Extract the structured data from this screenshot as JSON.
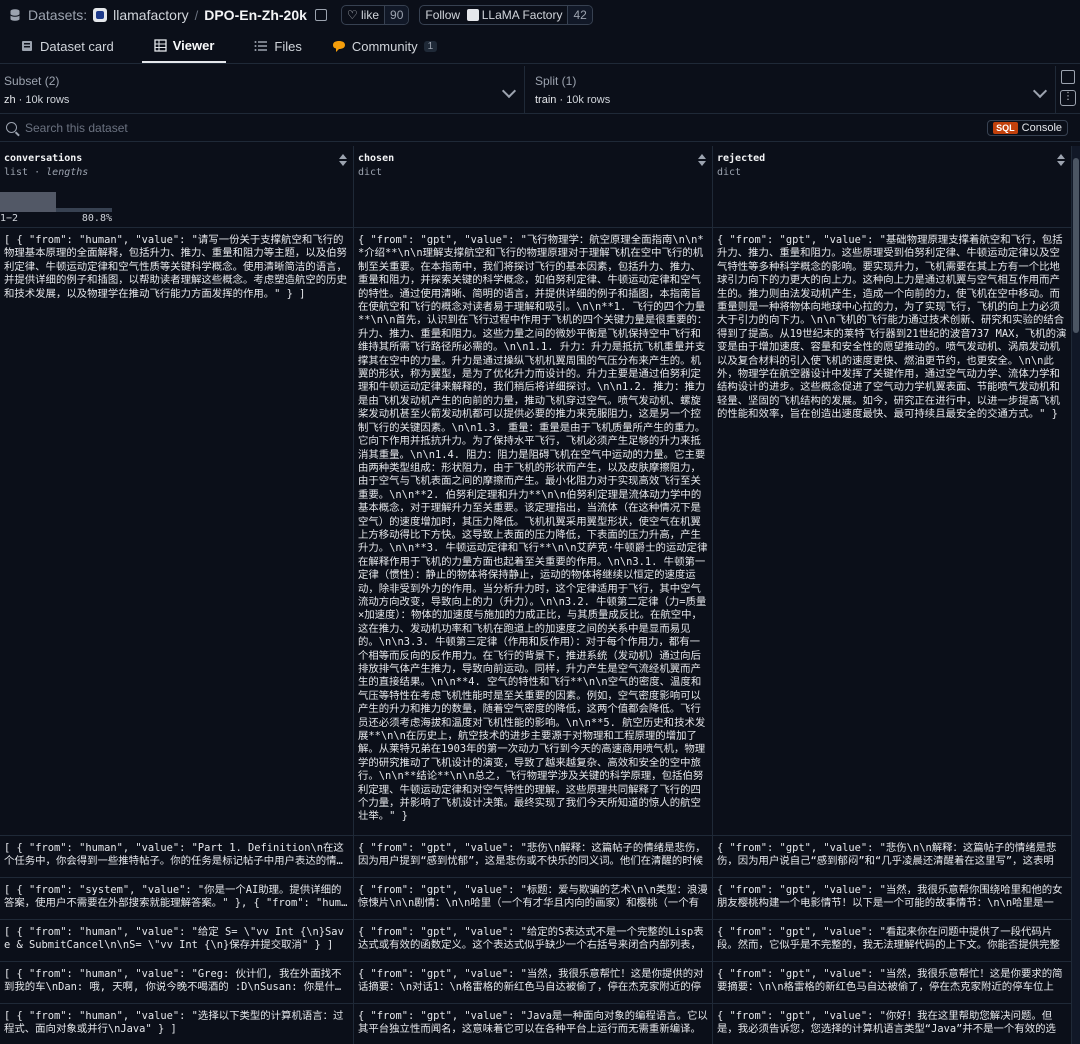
{
  "header": {
    "datasets_label": "Datasets:",
    "org": "llamafactory",
    "slash": "/",
    "dataset_name": "DPO-En-Zh-20k",
    "like_label": "like",
    "like_count": "90",
    "follow_label": "Follow",
    "follow_org": "LLaMA Factory",
    "follow_count": "42"
  },
  "tabs": [
    {
      "label": "Dataset card"
    },
    {
      "label": "Viewer"
    },
    {
      "label": "Files"
    },
    {
      "label": "Community",
      "badge": "1"
    }
  ],
  "subset": {
    "label": "Subset (2)",
    "value": "zh",
    "rows": "10k rows"
  },
  "split": {
    "label": "Split (1)",
    "value": "train",
    "rows": "10k rows"
  },
  "search": {
    "placeholder": "Search this dataset"
  },
  "sql": {
    "badge": "SQL",
    "label": "Console"
  },
  "columns": [
    {
      "name": "conversations",
      "type": "list",
      "subtype": "lengths",
      "hist_min": "1−2",
      "hist_pct": "80.8%"
    },
    {
      "name": "chosen",
      "type": "dict"
    },
    {
      "name": "rejected",
      "type": "dict"
    }
  ],
  "rows": [
    {
      "conversations": "[ { \"from\": \"human\", \"value\": \"请写一份关于支撑航空和飞行的物理基本原理的全面解释，包括升力、推力、重量和阻力等主题，以及伯努利定律、牛顿运动定律和空气性质等关键科学概念。使用清晰简洁的语言，并提供详细的例子和插图，以帮助读者理解这些概念。考虑塑造航空的历史和技术发展，以及物理学在推动飞行能力方面发挥的作用。\" } ]",
      "chosen": "{ \"from\": \"gpt\", \"value\": \"飞行物理学：航空原理全面指南\\n\\n**介绍**\\n\\n理解支撑航空和飞行的物理原理对于理解飞机在空中飞行的机制至关重要。在本指南中，我们将探讨飞行的基本因素，包括升力、推力、重量和阻力，并探索关键的科学概念，如伯努利定律、牛顿运动定律和空气的特性。通过使用清晰、简明的语言，并提供详细的例子和插图，本指南旨在使航空和飞行的概念对读者易于理解和吸引。\\n\\n**1. 飞行的四个力量**\\n\\n首先，认识到在飞行过程中作用于飞机的四个关键力量是很重要的：升力、推力、重量和阻力。这些力量之间的微妙平衡是飞机保持空中飞行和维持其所需飞行路径所必需的。\\n\\n1.1. 升力：升力是抵抗飞机重量并支撑其在空中的力量。升力是通过操纵飞机机翼周围的气压分布来产生的。机翼的形状，称为翼型，是为了优化升力而设计的。升力主要是通过伯努利定理和牛顿运动定律来解释的，我们稍后将详细探讨。\\n\\n1.2. 推力：推力是由飞机发动机产生的向前的力量，推动飞机穿过空气。喷气发动机、螺旋桨发动机甚至火箭发动机都可以提供必要的推力来克服阻力，这是另一个控制飞行的关键因素。\\n\\n1.3. 重量：重量是由于飞机质量所产生的重力。它向下作用并抵抗升力。为了保持水平飞行，飞机必须产生足够的升力来抵消其重量。\\n\\n1.4. 阻力：阻力是阻碍飞机在空气中运动的力量。它主要由两种类型组成：形状阻力，由于飞机的形状而产生，以及皮肤摩擦阻力，由于空气与飞机表面之间的摩擦而产生。最小化阻力对于实现高效飞行至关重要。\\n\\n**2. 伯努利定理和升力**\\n\\n伯努利定理是流体动力学中的基本概念，对于理解升力至关重要。该定理指出，当流体（在这种情况下是空气）的速度增加时，其压力降低。飞机机翼采用翼型形状，使空气在机翼上方移动得比下方快。这导致上表面的压力降低，下表面的压力升高，产生升力。\\n\\n**3. 牛顿运动定律和飞行**\\n\\n艾萨克·牛顿爵士的运动定律在解释作用于飞机的力量方面也起着至关重要的作用。\\n\\n3.1. 牛顿第一定律（惯性）：静止的物体将保持静止，运动的物体将继续以恒定的速度运动，除非受到外力的作用。当分析升力时，这个定律适用于飞行，其中空气流动方向改变，导致向上的力（升力）。\\n\\n3.2. 牛顿第二定律（力=质量×加速度）：物体的加速度与施加的力成正比，与其质量成反比。在航空中，这在推力、发动机功率和飞机在跑道上的加速度之间的关系中是显而易见的。\\n\\n3.3. 牛顿第三定律（作用和反作用）：对于每个作用力，都有一个相等而反向的反作用力。在飞行的背景下，推进系统（发动机）通过向后排放排气体产生推力，导致向前运动。同样，升力产生是空气流经机翼而产生的直接结果。\\n\\n**4. 空气的特性和飞行**\\n\\n空气的密度、温度和气压等特性在考虑飞机性能时是至关重要的因素。例如，空气密度影响可以产生的升力和推力的数量，随着空气密度的降低，这两个值都会降低。飞行员还必须考虑海拔和温度对飞机性能的影响。\\n\\n**5. 航空历史和技术发展**\\n\\n在历史上，航空技术的进步主要源于对物理和工程原理的增加了解。从莱特兄弟在1903年的第一次动力飞行到今天的高速商用喷气机，物理学的研究推动了飞机设计的演变，导致了越来越复杂、高效和安全的空中旅行。\\n\\n**结论**\\n\\n总之，飞行物理学涉及关键的科学原理，包括伯努利定理、牛顿运动定律和对空气特性的理解。这些原理共同解释了飞行的四个力量，并影响了飞机设计决策。最终实现了我们今天所知道的惊人的航空壮举。\" }",
      "rejected": "{ \"from\": \"gpt\", \"value\": \"基础物理原理支撑着航空和飞行，包括升力、推力、重量和阻力。这些原理受到伯努利定律、牛顿运动定律以及空气特性等多种科学概念的影响。要实现升力，飞机需要在其上方有一个比地球引力向下的力更大的向上力。这种向上力是通过机翼与空气相互作用而产生的。推力则由法发动机产生，造成一个向前的力，使飞机在空中移动。而重量则是一种将物体向地球中心拉的力，为了实现飞行，飞机的向上力必须大于引力的向下力。\\n\\n飞机的飞行能力通过技术创新、研究和实验的结合得到了提高。从19世纪末的莱特飞行器到21世纪的波音737 MAX，飞机的演变是由于增加速度、容量和安全性的愿望推动的。喷气发动机、涡扇发动机以及复合材料的引入使飞机的速度更快、燃油更节约，也更安全。\\n\\n此外，物理学在航空器设计中发挥了关键作用，通过空气动力学、流体力学和结构设计的进步。这些概念促进了空气动力学机翼表面、节能喷气发动机和轻量、坚固的飞机结构的发展。如今，研究正在进行中，以进一步提高飞机的性能和效率，旨在创造出速度最快、最可持续且最安全的交通方式。\" }"
    },
    {
      "conversations": "[ { \"from\": \"human\", \"value\": \"Part 1. Definition\\n在这个任务中，你会得到一些推特帖子。你的任务是标记帖子中用户表达的情绪，",
      "chosen": "{ \"from\": \"gpt\", \"value\": \"悲伤\\n解释：这篇帖子的情绪是悲伤，因为用户提到“感到忧郁”，这是悲伤或不快乐的同义词。他们在清醒的时候",
      "rejected": "{ \"from\": \"gpt\", \"value\": \"悲伤\\n\\n解释：这篇帖子的情绪是悲伤，因为用户说自己“感到郁闷”和“几乎凌晨还清醒着在这里写”，这表明"
    },
    {
      "conversations": "[ { \"from\": \"system\", \"value\": \"你是一个AI助理。提供详细的答案，使用户不需要在外部搜索就能理解答案。\" }, { \"from\": \"human\",",
      "chosen": "{ \"from\": \"gpt\", \"value\": \"标题：爱与欺骗的艺术\\n\\n类型：浪漫惊悚片\\n\\n剧情：\\n\\n哈里（一个有才华且内向的画家）和樱桃（一个有",
      "rejected": "{ \"from\": \"gpt\", \"value\": \"当然，我很乐意帮你围绕哈里和他的女朋友樱桃构建一个电影情节！以下是一个可能的故事情节：\\n\\n哈里是一"
    },
    {
      "conversations": "[ { \"from\": \"human\", \"value\": \"给定 S= \\\"vv Int {\\n}Save & SubmitCancel\\n\\nS= \\\"vv Int {\\n}保存并提交取消\" } ]",
      "chosen": "{ \"from\": \"gpt\", \"value\": \"给定的S表达式不是一个完整的Lisp表达式或有效的函数定义。这个表达式似乎缺少一个右括号来闭合内部列表，",
      "rejected": "{ \"from\": \"gpt\", \"value\": \"看起来你在问题中提供了一段代码片段。然而，它似乎是不完整的，我无法理解代码的上下文。你能否提供完整"
    },
    {
      "conversations": "[ { \"from\": \"human\", \"value\": \"Greg: 伙计们, 我在外面找不到我的车\\nDan: 哦, 天啊, 你说今晚不喝酒的 :D\\nSusan: 你是什么意",
      "chosen": "{ \"from\": \"gpt\", \"value\": \"当然，我很乐意帮忙！这是你提供的对话摘要：\\n对话1：\\n格雷格的新红色马自达被偷了，停在杰克家附近的停",
      "rejected": "{ \"from\": \"gpt\", \"value\": \"当然，我很乐意帮忙！这是你要求的简要摘要：\\n\\n格雷格的新红色马自达被偷了，停在杰克家附近的停车位上"
    },
    {
      "conversations": "[ { \"from\": \"human\", \"value\": \"选择以下类型的计算机语言：过程式、面向对象或并行\\nJava\" } ]",
      "chosen": "{ \"from\": \"gpt\", \"value\": \"Java是一种面向对象的编程语言。它以其平台独立性而闻名，这意味着它可以在各种平台上运行而无需重新编译。",
      "rejected": "{ \"from\": \"gpt\", \"value\": \"你好！我在这里帮助您解决问题。但是，我必须告诉您，您选择的计算机语言类型“Java”并不是一个有效的选"
    }
  ]
}
